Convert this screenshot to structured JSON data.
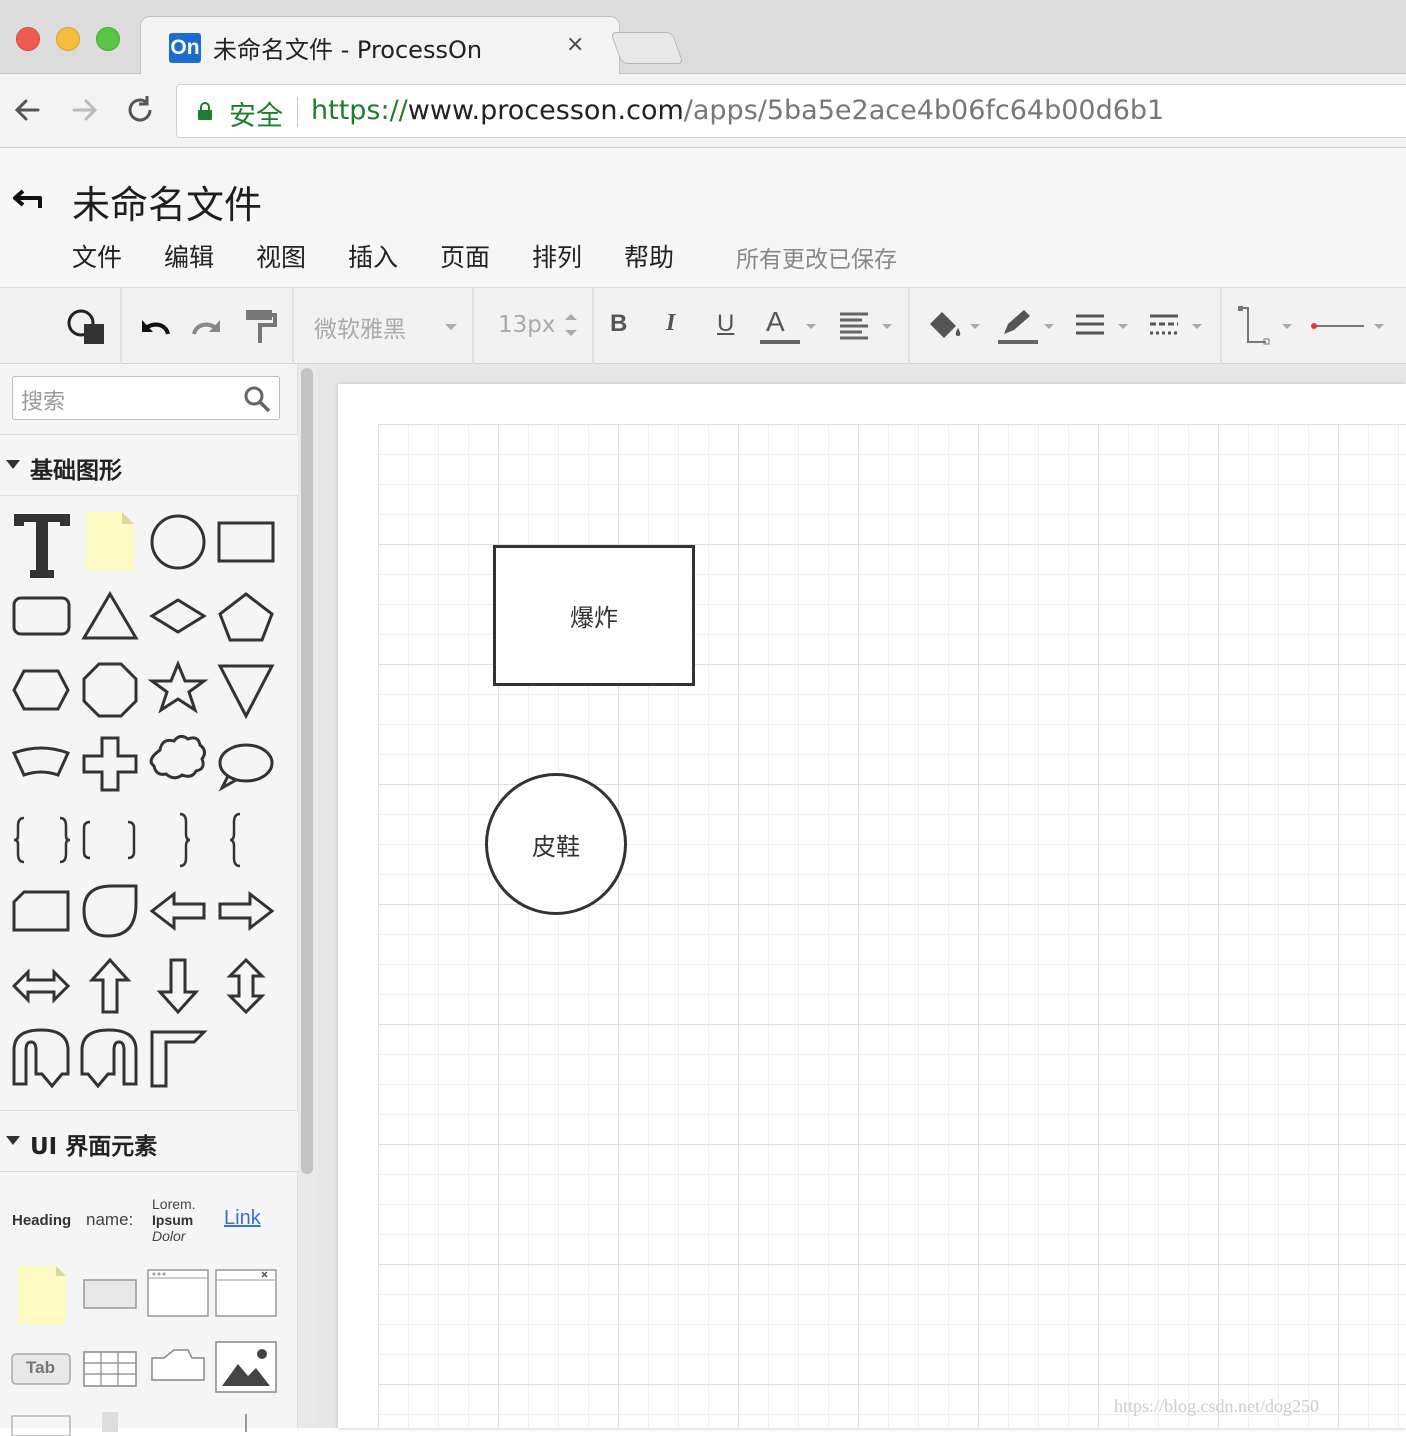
{
  "browser": {
    "tab_title": "未命名文件 - ProcessOn",
    "tab_favicon": "On",
    "tab_close": "×",
    "security_label": "安全",
    "url": {
      "scheme": "https://",
      "host": "www.processon.com",
      "path": "/apps/5ba5e2ace4b06fc64b00d6b1"
    }
  },
  "app": {
    "doc_title": "未命名文件",
    "menu": [
      "文件",
      "编辑",
      "视图",
      "插入",
      "页面",
      "排列",
      "帮助"
    ],
    "save_status": "所有更改已保存"
  },
  "toolbar": {
    "font_name": "微软雅黑",
    "font_size": "13px",
    "bold": "B",
    "italic": "I",
    "underline": "U",
    "font_color": "A"
  },
  "sidebar": {
    "search_placeholder": "搜索",
    "sections": [
      "基础图形",
      "UI 界面元素"
    ],
    "ui_labels": {
      "heading": "Heading",
      "name": "name:",
      "lorem1": "Lorem.",
      "lorem2": "Ipsum",
      "lorem3": "Dolor",
      "link": "Link",
      "tab": "Tab"
    }
  },
  "canvas": {
    "shapes": [
      {
        "type": "rectangle",
        "label": "爆炸"
      },
      {
        "type": "circle",
        "label": "皮鞋"
      }
    ]
  },
  "watermark": "https://blog.csdn.net/dog250",
  "colors": {
    "url_scheme": "#1d7c2e",
    "security": "#1d7c2e",
    "link": "#3b6fd8",
    "note": "#fffbc2"
  }
}
